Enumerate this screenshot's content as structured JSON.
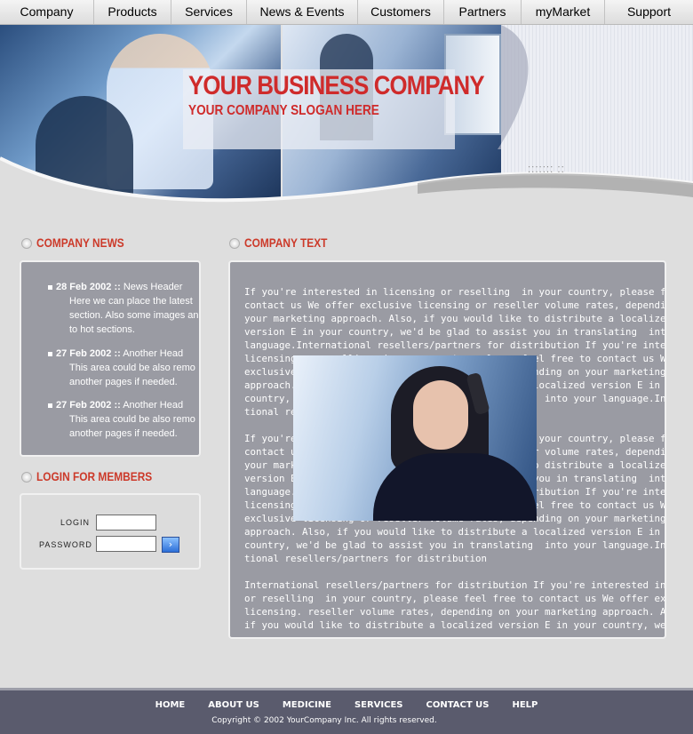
{
  "nav": {
    "items": [
      "Company",
      "Products",
      "Services",
      "News & Events",
      "Customers",
      "Partners",
      "myMarket",
      "Support"
    ]
  },
  "banner": {
    "title": "YOUR BUSINESS COMPANY",
    "slogan": "YOUR COMPANY SLOGAN HERE"
  },
  "news": {
    "title": "COMPANY NEWS",
    "items": [
      {
        "date": "28 Feb 2002",
        "sep": "::",
        "head": "News Header",
        "body": "Here we can place the latest section. Also some images an to hot sections."
      },
      {
        "date": "27 Feb 2002",
        "sep": "::",
        "head": "Another Head",
        "body": "This area could be also remo another pages if needed."
      },
      {
        "date": "27 Feb 2002",
        "sep": "::",
        "head": "Another Head",
        "body": "This area could be also remo another pages if needed."
      }
    ]
  },
  "login": {
    "title": "LOGIN FOR MEMBERS",
    "login_label": "LOGIN",
    "password_label": "PASSWORD",
    "go_symbol": "›"
  },
  "company": {
    "title": "COMPANY TEXT",
    "paragraphs": [
      "If you're interested in licensing or reselling  in your country, please feel free to\ncontact us We offer exclusive licensing or reseller volume rates, depending on\nyour marketing approach. Also, if you would like to distribute a localized\nversion E in your country, we'd be glad to assist you in translating  into your\nlanguage.International resellers/partners for distribution If you're interested in\nlicensing or reselling  in your country, please feel free to contact us We offer\nexclusive licensing or reseller volume rates, depending on your marketing\napproach. Also, if you would like to distribute a localized version E in your\ncountry, we'd be glad to assist you in translating  into your language.Interna-\ntional resellers/partners for distribution",
      "If you're interested in licensing or reselling  in your country, please feel free to\ncontact us We offer exclusive licensing or reseller volume rates, depending on\nyour marketing approach. Also, if you would like to distribute a localized\nversion E in your country, we'd be glad to assist you in translating  into your\nlanguage.International resellers/partners for distribution If you're interested in\nlicensing or reselling  in your country, please feel free to contact us We offer\nexclusive licensing or reseller volume rates, depending on your marketing\napproach. Also, if you would like to distribute a localized version E in your\ncountry, we'd be glad to assist you in translating  into your language.Interna-\ntional resellers/partners for distribution",
      "International resellers/partners for distribution If you're interested in licensing\nor reselling  in your country, please feel free to contact us We offer exclusive\nlicensing. reseller volume rates, depending on your marketing approach. Also,\nif you would like to distribute a localized version E in your country, we'd be glad"
    ]
  },
  "footer": {
    "links": [
      "HOME",
      "ABOUT US",
      "MEDICINE",
      "SERVICES",
      "CONTACT US",
      "HELP"
    ],
    "copyright": "Copyright © 2002 YourCompany Inc. All rights reserved."
  }
}
